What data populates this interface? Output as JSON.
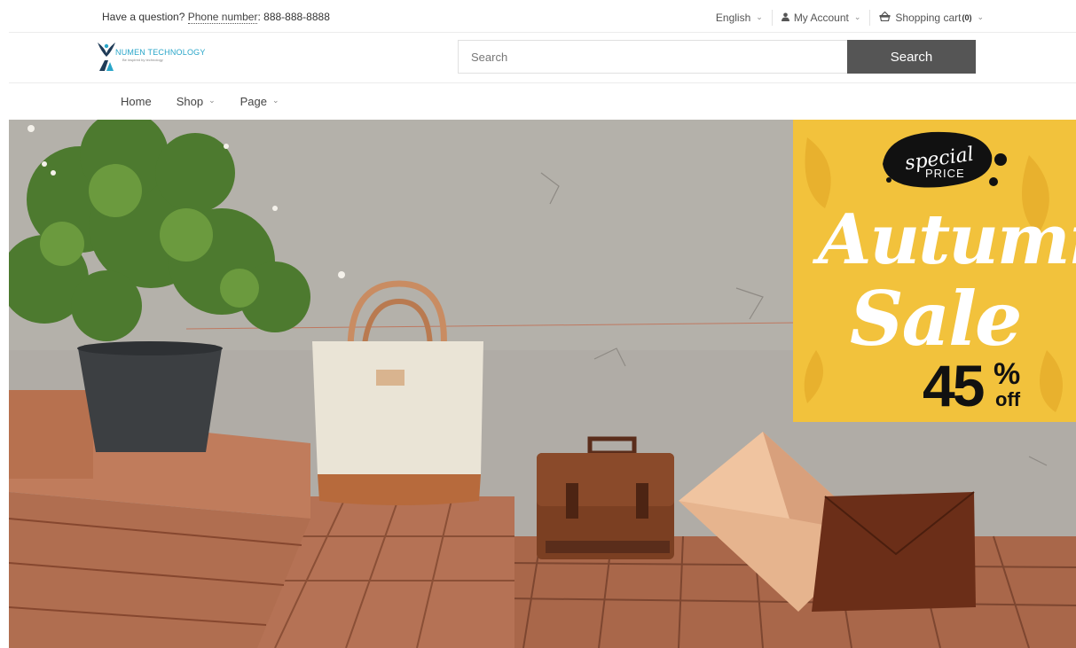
{
  "topbar": {
    "question_prefix": "Have a question? ",
    "phone_label": "Phone number",
    "phone_sep": ": ",
    "phone_value": "888-888-8888",
    "language": "English",
    "account": "My Account",
    "cart_label": "Shopping cart",
    "cart_count": "(0)"
  },
  "logo": {
    "name": "NUMEN TECHNOLOGY",
    "tagline": "Be inspired by technology"
  },
  "search": {
    "placeholder": "Search",
    "button_label": "Search"
  },
  "nav": {
    "items": [
      {
        "label": "Home"
      },
      {
        "label": "Shop"
      },
      {
        "label": "Page"
      }
    ]
  },
  "hero": {
    "badge_line1": "special",
    "badge_line2": "PRICE",
    "sale_word1": "Autumn",
    "sale_word2": "Sale",
    "discount_value": "45",
    "discount_unit": "%",
    "discount_suffix": "off"
  },
  "colors": {
    "accent": "#2aa6c9",
    "search_button": "#555555",
    "banner_yellow": "#f2c23c"
  }
}
